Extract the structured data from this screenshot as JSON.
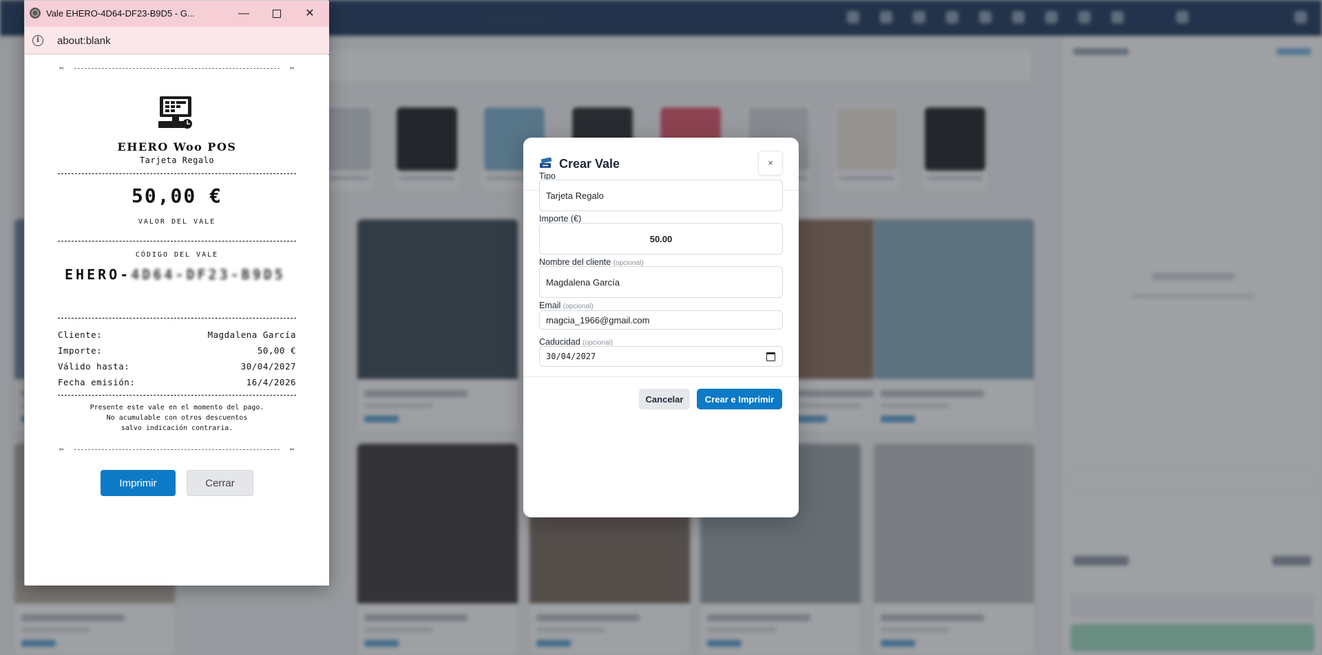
{
  "popup": {
    "window_title": "Vale EHERO-4D64-DF23-B9D5 - G...",
    "address": "about:blank",
    "receipt": {
      "store_name": "EHERO Woo POS",
      "voucher_type": "Tarjeta Regalo",
      "amount": "50,00 €",
      "amount_caption": "VALOR DEL VALE",
      "code_caption": "CÓDIGO DEL VALE",
      "code_prefix": "EHERO-",
      "code_rest": "4D64-DF23-B9D5",
      "rows": [
        {
          "key": "Cliente:",
          "value": "Magdalena García"
        },
        {
          "key": "Importe:",
          "value": "50,00 €"
        },
        {
          "key": "Válido hasta:",
          "value": "30/04/2027"
        },
        {
          "key": "Fecha emisión:",
          "value": "16/4/2026"
        }
      ],
      "note_line1": "Presente este vale en el momento del pago.",
      "note_line2": "No acumulable con otros descuentos",
      "note_line3": "salvo indicación contraria.",
      "print_label": "Imprimir",
      "close_label": "Cerrar"
    }
  },
  "modal": {
    "title": "Crear Vale",
    "close_glyph": "×",
    "fields": {
      "tipo_label": "Tipo",
      "tipo_value": "Tarjeta Regalo",
      "importe_label": "Importe (€)",
      "importe_value": "50.00",
      "nombre_label": "Nombre del cliente",
      "nombre_optional": "(opcional)",
      "nombre_value": "Magdalena García",
      "email_label": "Email",
      "email_optional": "(opcional)",
      "email_value": "magcia_1966@gmail.com",
      "caducidad_label": "Caducidad",
      "caducidad_optional": "(opcional)",
      "caducidad_value": "30/04/2027"
    },
    "cancel_label": "Cancelar",
    "create_label": "Crear e Imprimir"
  },
  "colors": {
    "primary": "#0d7ac7",
    "topbar": "#1e3a5f",
    "popup_titlebar": "#f6cfd6"
  },
  "icons": [
    "globe-icon",
    "info-icon",
    "minimize-icon",
    "maximize-icon",
    "close-icon",
    "cash-register-icon",
    "scissors-icon",
    "ticket-icon",
    "calendar-icon"
  ]
}
